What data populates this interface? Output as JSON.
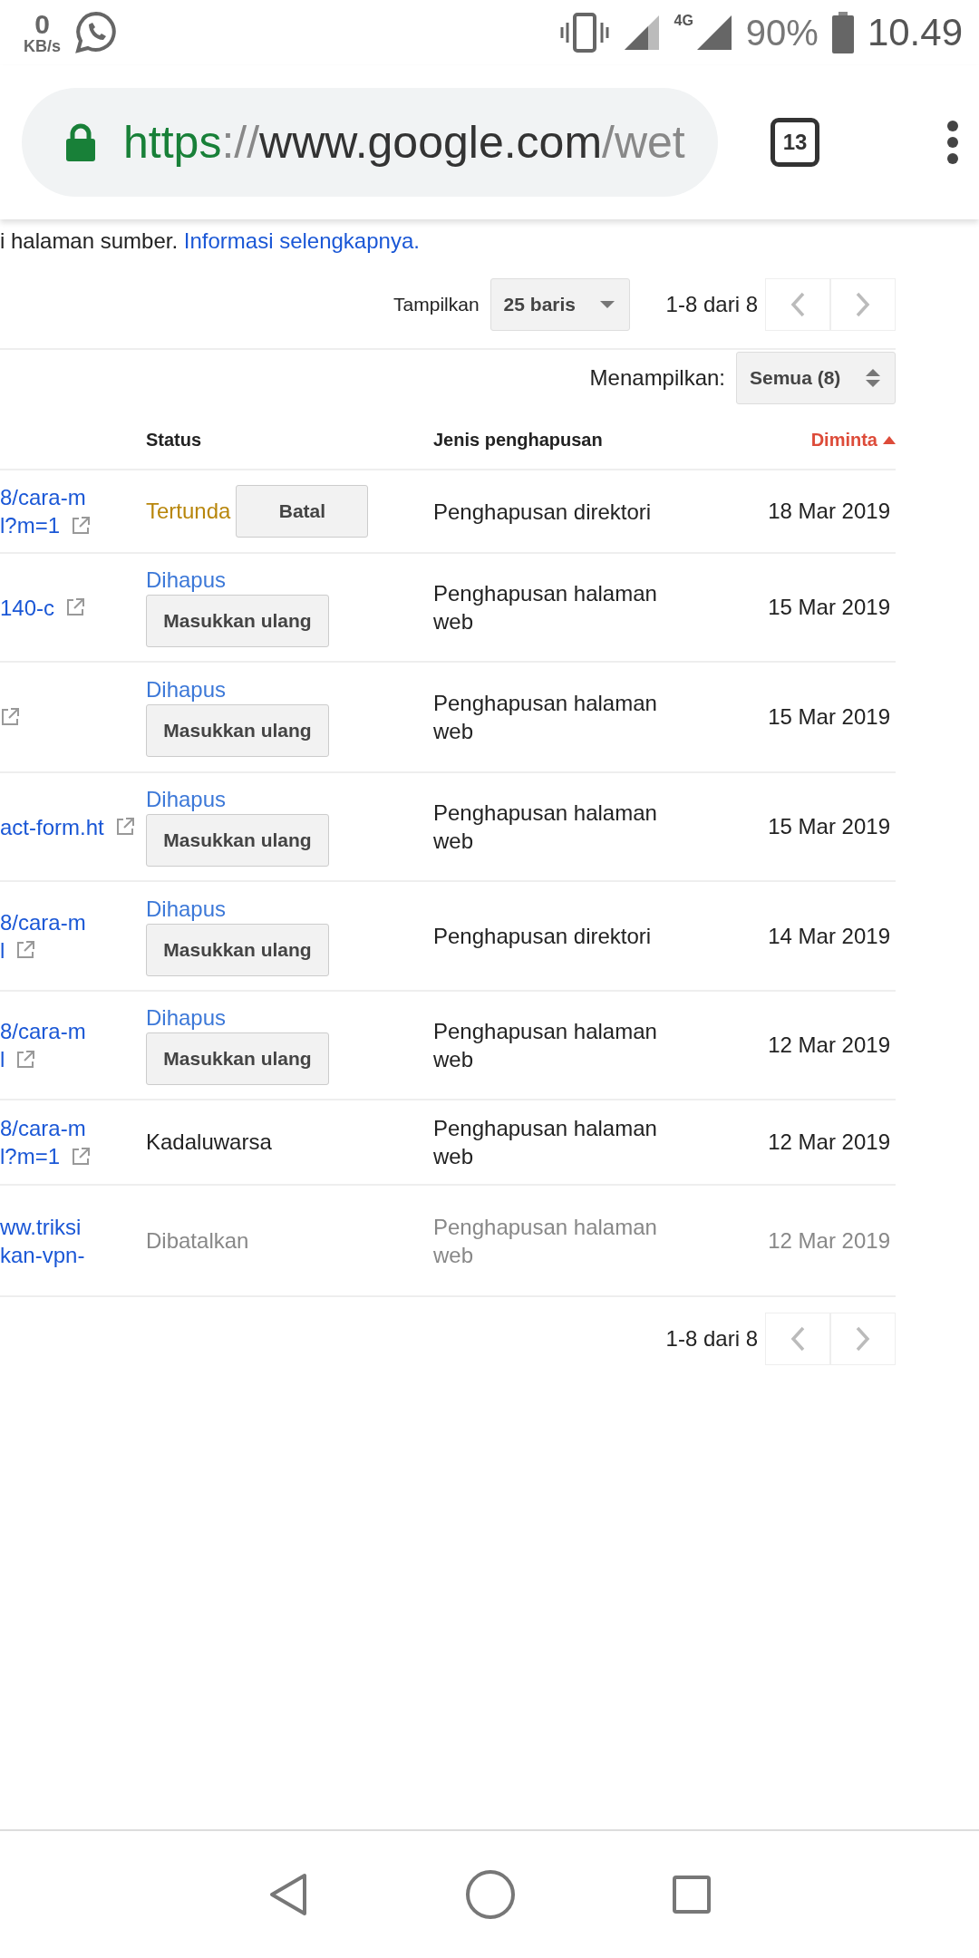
{
  "status_bar": {
    "speed_value": "0",
    "speed_unit": "KB/s",
    "network": "4G",
    "battery": "90%",
    "time": "10.49"
  },
  "browser": {
    "url_scheme": "https",
    "url_separator": "://",
    "url_host": "www.google.com",
    "url_path": "/wet",
    "tab_count": "13"
  },
  "intro": {
    "text": "i halaman sumber.",
    "link": "Informasi selengkapnya."
  },
  "pager_top": {
    "show_label": "Tampilkan",
    "rows_option": "25 baris",
    "range": "1-8 dari 8"
  },
  "filter": {
    "label": "Menampilkan:",
    "value": "Semua (8)"
  },
  "table": {
    "columns": [
      {
        "label": "Status",
        "sorted": false
      },
      {
        "label": "Jenis penghapusan",
        "sorted": false
      },
      {
        "label": "Diminta",
        "sorted": true
      }
    ],
    "rows": [
      {
        "url": [
          "8/cara-m",
          "l?m=1"
        ],
        "status": "Tertunda",
        "kind": "pending",
        "action": "Batal",
        "type": "Penghapusan direktori",
        "date": "18 Mar 2019"
      },
      {
        "url": [
          "140-c"
        ],
        "status": "Dihapus",
        "kind": "removed",
        "action": "Masukkan ulang",
        "type": "Penghapusan halaman web",
        "date": "15 Mar 2019"
      },
      {
        "url": [],
        "status": "Dihapus",
        "kind": "removed",
        "action": "Masukkan ulang",
        "type": "Penghapusan halaman web",
        "date": "15 Mar 2019"
      },
      {
        "url": [
          "act-form.ht"
        ],
        "status": "Dihapus",
        "kind": "removed",
        "action": "Masukkan ulang",
        "type": "Penghapusan halaman web",
        "date": "15 Mar 2019"
      },
      {
        "url": [
          "8/cara-m",
          "l"
        ],
        "status": "Dihapus",
        "kind": "removed",
        "action": "Masukkan ulang",
        "type": "Penghapusan direktori",
        "date": "14 Mar 2019"
      },
      {
        "url": [
          "8/cara-m",
          "l"
        ],
        "status": "Dihapus",
        "kind": "removed",
        "action": "Masukkan ulang",
        "type": "Penghapusan halaman web",
        "date": "12 Mar 2019"
      },
      {
        "url": [
          "8/cara-m",
          "l?m=1"
        ],
        "status": "Kadaluwarsa",
        "kind": "expired",
        "type": "Penghapusan halaman web",
        "date": "12 Mar 2019"
      },
      {
        "url": [
          "ww.triksi",
          "kan-vpn-"
        ],
        "status": "Dibatalkan",
        "kind": "cancelled",
        "type": "Penghapusan halaman web",
        "date": "12 Mar 2019"
      }
    ]
  },
  "pager_bottom": {
    "range": "1-8 dari 8"
  }
}
